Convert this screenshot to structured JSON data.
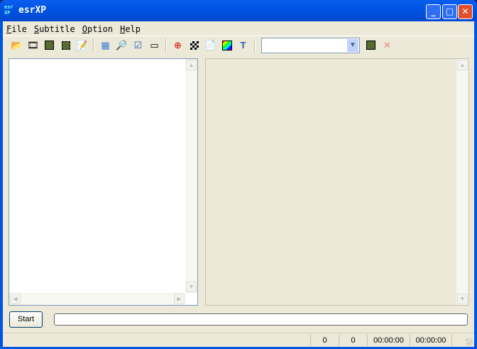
{
  "window": {
    "title": "esrXP",
    "logo": "esr XP"
  },
  "menu": [
    {
      "u": "F",
      "rest": "ile"
    },
    {
      "u": "S",
      "rest": "ubtitle"
    },
    {
      "u": "O",
      "rest": "ption"
    },
    {
      "u": "H",
      "rest": "elp"
    }
  ],
  "toolbar": {
    "combo_value": ""
  },
  "start_label": "Start",
  "progress": 0,
  "status": {
    "count1": "0",
    "count2": "0",
    "time1": "00:00:00",
    "time2": "00:00:00"
  }
}
